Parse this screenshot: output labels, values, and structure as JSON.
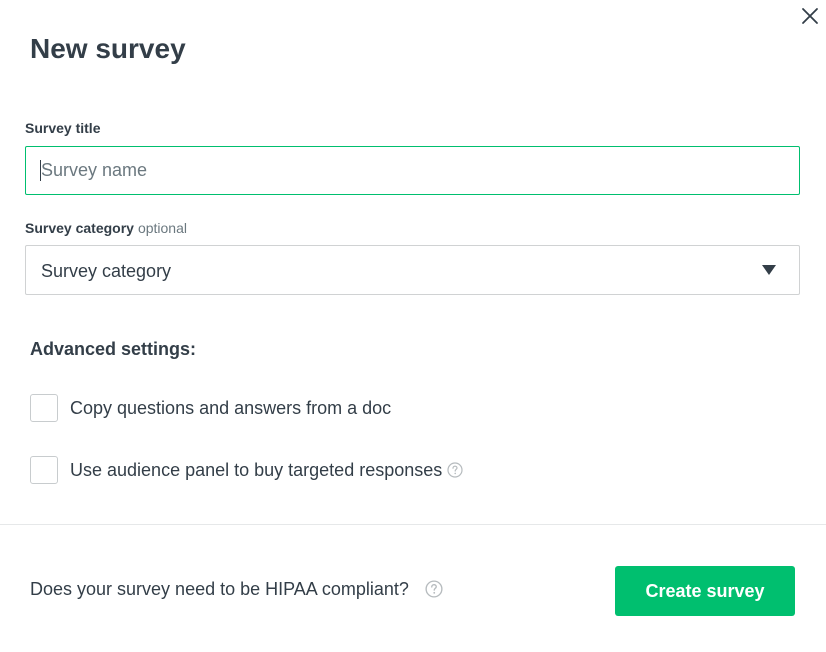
{
  "dialog": {
    "title": "New survey",
    "close_icon": "close-icon"
  },
  "survey_title": {
    "label": "Survey title",
    "placeholder": "Survey name",
    "value": ""
  },
  "survey_category": {
    "label": "Survey category",
    "optional_text": "optional",
    "selected_value": "Survey category",
    "dropdown_icon": "caret-down-icon"
  },
  "advanced_settings": {
    "heading": "Advanced settings:",
    "options": [
      {
        "label": "Copy questions and answers from a doc",
        "checked": false
      },
      {
        "label": "Use audience panel to buy targeted responses",
        "checked": false,
        "help_icon": "question-circle-icon"
      }
    ]
  },
  "footer": {
    "hipaa_question": "Does your survey need to be HIPAA compliant?",
    "help_icon": "question-circle-icon",
    "create_button_label": "Create survey"
  },
  "colors": {
    "accent": "#00bf6f",
    "text": "#333e48",
    "muted": "#6b787f",
    "border": "#d0d2d3"
  }
}
